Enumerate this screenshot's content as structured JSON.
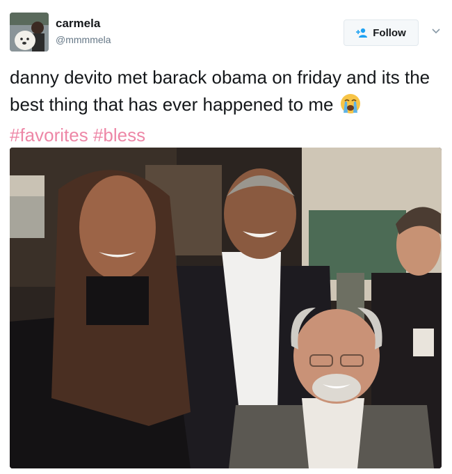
{
  "tweet": {
    "author": {
      "display_name": "carmela",
      "handle": "@mmmmela"
    },
    "follow_label": "Follow",
    "text_main": "danny devito met barack obama on friday and its the best thing that has ever happened to me",
    "emoji": "loudly-crying-face",
    "hashtags": [
      "#favorites",
      "#bless"
    ]
  },
  "colors": {
    "text": "#14171a",
    "handle": "#657786",
    "hashtag": "#e0245e",
    "follow_icon": "#1da1f2"
  },
  "icons": {
    "follow": "add-person-icon",
    "caret": "chevron-down-icon"
  }
}
